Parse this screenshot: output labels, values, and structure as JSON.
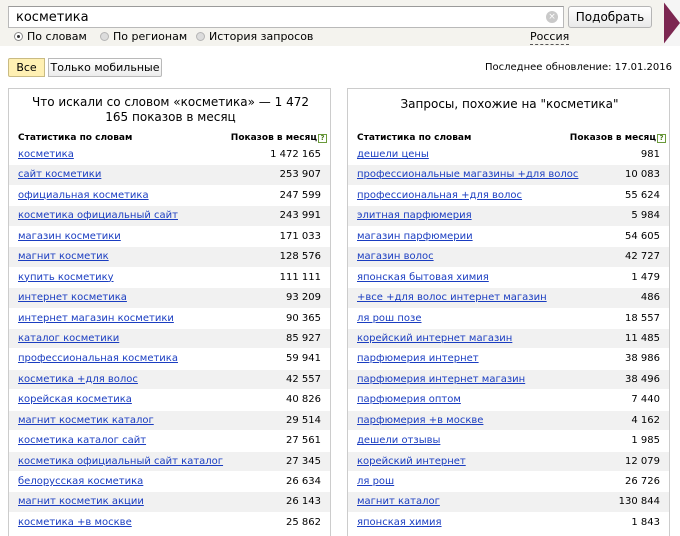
{
  "search": {
    "value": "косметика",
    "clear_glyph": "×",
    "submit_label": "Подобрать"
  },
  "modes": [
    {
      "label": "По словам",
      "selected": true
    },
    {
      "label": "По регионам",
      "selected": false
    },
    {
      "label": "История запросов",
      "selected": false
    }
  ],
  "region": "Россия",
  "filters": {
    "all": "Все",
    "mobile": "Только мобильные"
  },
  "updated": "Последнее обновление: 17.01.2016",
  "left": {
    "title": "Что искали со словом «косметика» — 1 472 165 показов в месяц",
    "col_phrase": "Статистика по словам",
    "col_count": "Показов в месяц",
    "rows": [
      {
        "phrase": "косметика",
        "count": "1 472 165"
      },
      {
        "phrase": "сайт косметики",
        "count": "253 907"
      },
      {
        "phrase": "официальная косметика",
        "count": "247 599"
      },
      {
        "phrase": "косметика официальный сайт",
        "count": "243 991"
      },
      {
        "phrase": "магазин косметики",
        "count": "171 033"
      },
      {
        "phrase": "магнит косметик",
        "count": "128 576"
      },
      {
        "phrase": "купить косметику",
        "count": "111 111"
      },
      {
        "phrase": "интернет косметика",
        "count": "93 209"
      },
      {
        "phrase": "интернет магазин косметики",
        "count": "90 365"
      },
      {
        "phrase": "каталог косметики",
        "count": "85 927"
      },
      {
        "phrase": "профессиональная косметика",
        "count": "59 941"
      },
      {
        "phrase": "косметика +для волос",
        "count": "42 557"
      },
      {
        "phrase": "корейская косметика",
        "count": "40 826"
      },
      {
        "phrase": "магнит косметик каталог",
        "count": "29 514"
      },
      {
        "phrase": "косметика каталог сайт",
        "count": "27 561"
      },
      {
        "phrase": "косметика официальный сайт каталог",
        "count": "27 345"
      },
      {
        "phrase": "белорусская косметика",
        "count": "26 634"
      },
      {
        "phrase": "магнит косметик акции",
        "count": "26 143"
      },
      {
        "phrase": "косметика +в москве",
        "count": "25 862"
      }
    ]
  },
  "right": {
    "title": "Запросы, похожие на \"косметика\"",
    "col_phrase": "Статистика по словам",
    "col_count": "Показов в месяц",
    "rows": [
      {
        "phrase": "дешели цены",
        "count": "981"
      },
      {
        "phrase": "профессиональные магазины +для волос",
        "count": "10 083"
      },
      {
        "phrase": "профессиональная +для волос",
        "count": "55 624"
      },
      {
        "phrase": "элитная парфюмерия",
        "count": "5 984"
      },
      {
        "phrase": "магазин парфюмерии",
        "count": "54 605"
      },
      {
        "phrase": "магазин волос",
        "count": "42 727"
      },
      {
        "phrase": "японская бытовая химия",
        "count": "1 479"
      },
      {
        "phrase": "+все +для волос интернет магазин",
        "count": "486"
      },
      {
        "phrase": "ля рош позе",
        "count": "18 557"
      },
      {
        "phrase": "корейский интернет магазин",
        "count": "11 485"
      },
      {
        "phrase": "парфюмерия интернет",
        "count": "38 986"
      },
      {
        "phrase": "парфюмерия интернет магазин",
        "count": "38 496"
      },
      {
        "phrase": "парфюмерия оптом",
        "count": "7 440"
      },
      {
        "phrase": "парфюмерия +в москве",
        "count": "4 162"
      },
      {
        "phrase": "дешели отзывы",
        "count": "1 985"
      },
      {
        "phrase": "корейский интернет",
        "count": "12 079"
      },
      {
        "phrase": "ля рош",
        "count": "26 726"
      },
      {
        "phrase": "магнит каталог",
        "count": "130 844"
      },
      {
        "phrase": "японская химия",
        "count": "1 843"
      }
    ]
  }
}
